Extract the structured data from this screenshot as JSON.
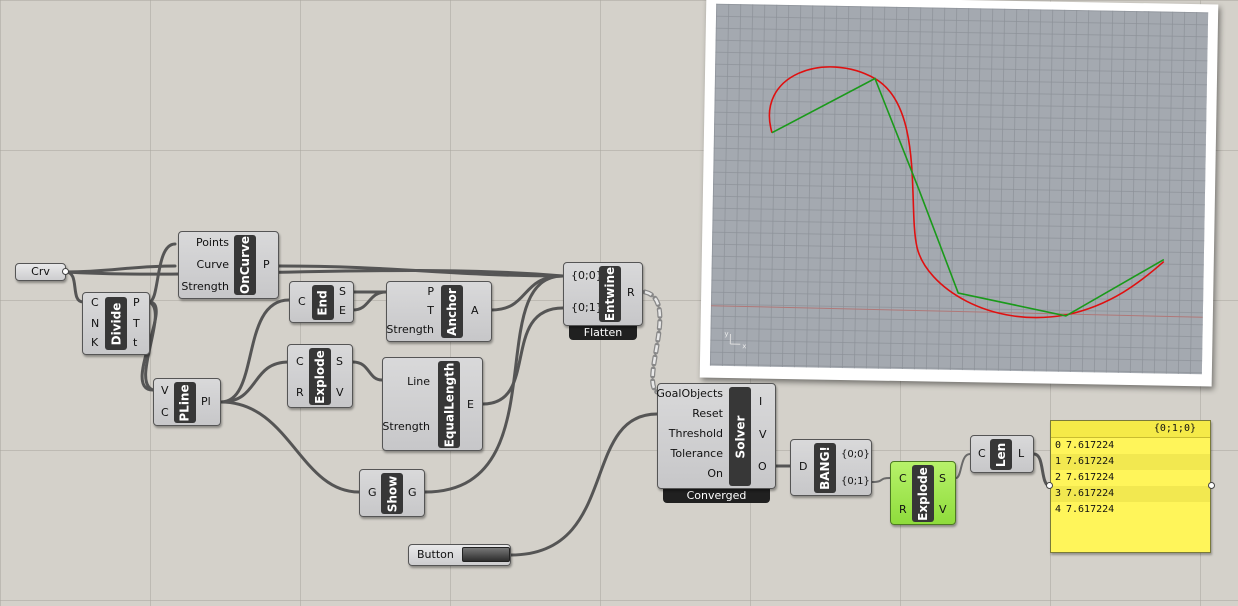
{
  "canvas": {
    "crv_param": "Crv",
    "divide": {
      "nick": "Divide",
      "inputs": [
        "C",
        "N",
        "K"
      ],
      "outputs": [
        "P",
        "T",
        "t"
      ]
    },
    "oncurve": {
      "nick": "OnCurve",
      "inputs": [
        "Points",
        "Curve",
        "Strength"
      ],
      "outputs": [
        "P"
      ]
    },
    "end": {
      "nick": "End",
      "inputs": [
        "C"
      ],
      "outputs": [
        "S",
        "E"
      ]
    },
    "anchor": {
      "nick": "Anchor",
      "inputs": [
        "P",
        "T",
        "Strength"
      ],
      "outputs": [
        "A"
      ]
    },
    "entwine": {
      "nick": "Entwine",
      "inputs": [
        "{0;0}",
        "{0;1}"
      ],
      "outputs": [
        "R"
      ],
      "footer": "Flatten"
    },
    "pline": {
      "nick": "PLine",
      "inputs": [
        "V",
        "C"
      ],
      "outputs": [
        "Pl"
      ]
    },
    "explode1": {
      "nick": "Explode",
      "inputs": [
        "C",
        "R"
      ],
      "outputs": [
        "S",
        "V"
      ]
    },
    "equallength": {
      "nick": "EqualLength",
      "inputs": [
        "Line",
        "Strength"
      ],
      "outputs": [
        "E"
      ]
    },
    "show": {
      "nick": "Show",
      "inputs": [
        "G"
      ],
      "outputs": [
        "G"
      ]
    },
    "solver": {
      "nick": "Solver",
      "inputs": [
        "GoalObjects",
        "Reset",
        "Threshold",
        "Tolerance",
        "On"
      ],
      "outputs": [
        "I",
        "V",
        "O"
      ],
      "footer": "Converged"
    },
    "bang": {
      "nick": "BANG!",
      "inputs": [
        "D"
      ],
      "outputs": [
        "{0;0}",
        "{0;1}"
      ]
    },
    "explode2": {
      "nick": "Explode",
      "inputs": [
        "C",
        "R"
      ],
      "outputs": [
        "S",
        "V"
      ]
    },
    "len": {
      "nick": "Len",
      "inputs": [
        "C"
      ],
      "outputs": [
        "L"
      ]
    },
    "button": {
      "label": "Button"
    },
    "panel": {
      "header": "{0;1;0}",
      "rows": [
        {
          "index": "0",
          "value": "7.617224"
        },
        {
          "index": "1",
          "value": "7.617224"
        },
        {
          "index": "2",
          "value": "7.617224"
        },
        {
          "index": "3",
          "value": "7.617224"
        },
        {
          "index": "4",
          "value": "7.617224"
        }
      ]
    }
  },
  "viewport": {
    "axis_labels": [
      "y",
      "x"
    ],
    "colors": {
      "curve": "#e01010",
      "polyline": "#1a9a1a",
      "background": "#a4a9b0"
    }
  },
  "colors": {
    "canvas": "#d4d1ca",
    "component": "#c9c9cb",
    "selected": "#9ade4a",
    "panel": "#fff55a"
  }
}
